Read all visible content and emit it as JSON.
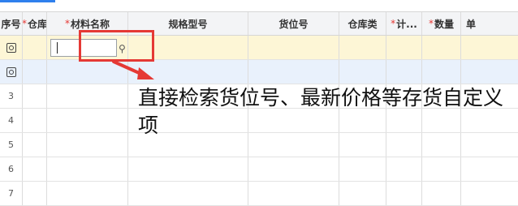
{
  "header": {
    "seq": "序号",
    "warehouse": "仓库",
    "material_name": "材料名称",
    "spec": "规格型号",
    "location": "货位号",
    "warehouse_type": "仓库类",
    "measure": "计...",
    "quantity": "数量",
    "unit": "单",
    "required_mark": "*"
  },
  "rows": {
    "r3": "3",
    "r4": "4",
    "r5": "5",
    "r6": "6",
    "r7": "7"
  },
  "annotation": {
    "text": "直接检索货位号、最新价格等存货自定义项",
    "highlight_color": "#e53935"
  },
  "icons": {
    "row_settings": "settings-icon",
    "search": "search-icon",
    "arrow": "red-arrow-icon"
  }
}
